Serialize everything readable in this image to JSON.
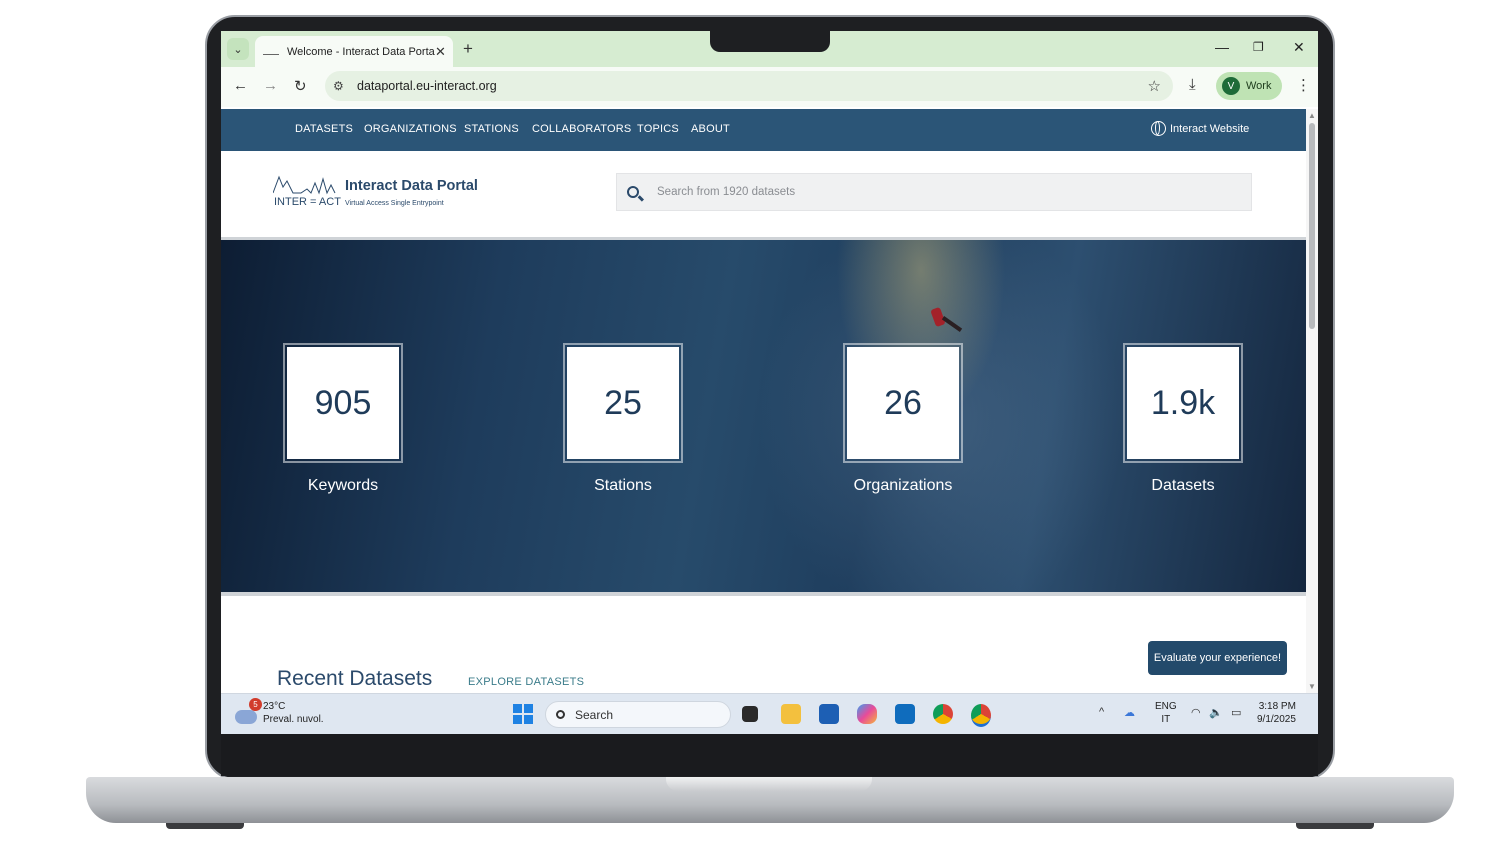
{
  "browser": {
    "tab_title": "Welcome - Interact Data Portal",
    "tab_close": "✕",
    "new_tab": "+",
    "url": "dataportal.eu-interact.org",
    "profile_initial": "V",
    "profile_label": "Work"
  },
  "site": {
    "nav": [
      "DATASETS",
      "ORGANIZATIONS",
      "STATIONS",
      "COLLABORATORS",
      "TOPICS",
      "ABOUT"
    ],
    "website_link": "Interact Website",
    "logo": {
      "wordmark": "INTER = ACT",
      "title": "Interact Data Portal",
      "subtitle": "Virtual Access Single Entrypoint"
    },
    "search_placeholder": "Search from 1920 datasets",
    "stats": [
      {
        "value": "905",
        "label": "Keywords"
      },
      {
        "value": "25",
        "label": "Stations"
      },
      {
        "value": "26",
        "label": "Organizations"
      },
      {
        "value": "1.9k",
        "label": "Datasets"
      }
    ],
    "recent_title": "Recent Datasets",
    "explore_link": "EXPLORE DATASETS",
    "evaluate_button": "Evaluate your experience!"
  },
  "taskbar": {
    "weather_badge": "5",
    "temperature": "23°C",
    "weather_desc": "Preval. nuvol.",
    "search_label": "Search",
    "lang_1": "ENG",
    "lang_2": "IT",
    "time": "3:18 PM",
    "date": "9/1/2025"
  },
  "colors": {
    "site_nav": "#2b5577",
    "brand_text": "#2b4a6b",
    "tab_strip": "#d6ecd1",
    "evaluate_button": "#234a6b"
  }
}
